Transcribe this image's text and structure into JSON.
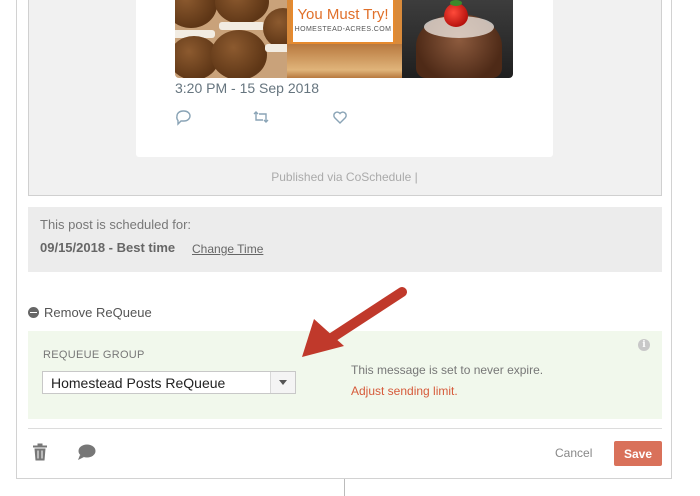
{
  "tweet": {
    "image_banner_title": "You Must Try!",
    "image_banner_site": "HOMESTEAD-ACRES.COM",
    "timestamp": "3:20 PM - 15 Sep 2018",
    "actions": [
      "reply-icon",
      "retweet-icon",
      "like-icon"
    ]
  },
  "published_via": "Published via CoSchedule |",
  "schedule": {
    "label": "This post is scheduled for:",
    "date": "09/15/2018 - Best time",
    "change_link": "Change Time"
  },
  "requeue": {
    "remove_label": "Remove ReQueue",
    "group_label": "REQUEUE GROUP",
    "group_value": "Homestead Posts ReQueue",
    "expire_text": "This message is set to never expire.",
    "adjust_link": "Adjust sending limit.",
    "info_glyph": "i"
  },
  "footer": {
    "cancel_label": "Cancel",
    "save_label": "Save"
  },
  "colors": {
    "accent": "#d9715a",
    "link": "#d65a3a",
    "arrow": "#c0392b",
    "requeue_bg": "#f1f8ec",
    "schedule_bg": "#ececec"
  }
}
